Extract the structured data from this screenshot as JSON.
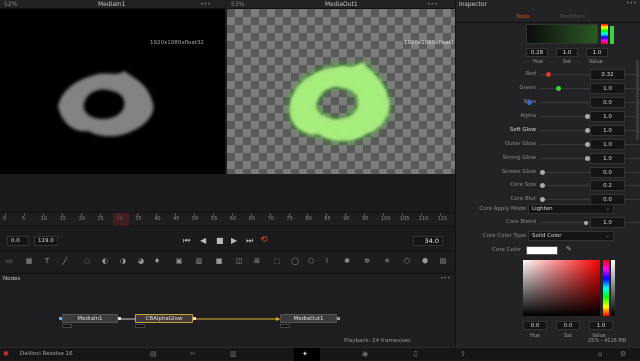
{
  "viewer_left": {
    "zoom": "52%",
    "title": "MediaIn1",
    "resolution": "1920x1080xfloat32"
  },
  "viewer_right": {
    "zoom": "53%",
    "title": "MediaOut1",
    "resolution": "1920x1080xfloat16"
  },
  "inspector": {
    "title": "Inspector",
    "tabs": [
      "Tools",
      "Modifiers"
    ],
    "color_wheel": {
      "hue": "0.28",
      "sat": "1.0",
      "value": "1.0",
      "hue_label": "Hue",
      "sat_label": "Sat",
      "value_label": "Value"
    },
    "params": [
      {
        "label": "Red",
        "value": "0.32",
        "color": "#d23b3b"
      },
      {
        "label": "Green",
        "value": "1.0",
        "color": "#3bd23b"
      },
      {
        "label": "Blue",
        "value": "0.0",
        "color": "#3b6ad2"
      },
      {
        "label": "Alpha",
        "value": "1.0",
        "color": ""
      },
      {
        "label": "Soft Glow",
        "value": "1.0",
        "color": ""
      },
      {
        "label": "Outer Glow",
        "value": "1.0",
        "color": ""
      },
      {
        "label": "Strong Glow",
        "value": "1.0",
        "color": ""
      },
      {
        "label": "Screen Glow",
        "value": "0.0",
        "color": ""
      },
      {
        "label": "Core Size",
        "value": "0.2",
        "color": ""
      },
      {
        "label": "Core Blur",
        "value": "0.0",
        "color": ""
      }
    ],
    "core_apply_mode": {
      "label": "Core Apply Mode",
      "value": "Lighten"
    },
    "core_blend": {
      "label": "Core Blend",
      "value": "1.0"
    },
    "core_color_type": {
      "label": "Core Color Type",
      "value": "Solid Color"
    },
    "core_color": {
      "label": "Core Color",
      "swatch": "#ffffff"
    },
    "picker": {
      "h": "0.0",
      "s": "0.0",
      "v": "1.0",
      "h_label": "Hue",
      "s_label": "Sat",
      "v_label": "Value"
    }
  },
  "timeline": {
    "ticks": [
      "0",
      "5",
      "10",
      "15",
      "20",
      "25",
      "30",
      "35",
      "40",
      "45",
      "50",
      "55",
      "60",
      "65",
      "70",
      "75",
      "80",
      "85",
      "90",
      "95",
      "100",
      "105",
      "110",
      "115"
    ],
    "start": "0.0",
    "end": "119.0",
    "current": "34.0"
  },
  "nodes": {
    "title": "Nodes",
    "items": [
      "MediaIn1",
      "CBAlphaGlow",
      "MediaOut1"
    ]
  },
  "status": {
    "app": "DaVinci Resolve 16",
    "playback": "Playback: 24 frames/sec",
    "memory": "25% - 4116 MB"
  },
  "colors": {
    "accent": "#e0501d",
    "glow": "#5cf01e",
    "timeline_accent": "#c73535"
  }
}
